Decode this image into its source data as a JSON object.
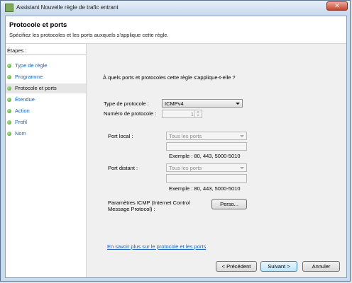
{
  "window": {
    "title": "Assistant Nouvelle règle de trafic entrant"
  },
  "header": {
    "title": "Protocole et ports",
    "subtitle": "Spécifiez les protocoles et les ports auxquels s'applique cette règle."
  },
  "sidebar": {
    "title": "Étapes :",
    "items": [
      {
        "label": "Type de règle",
        "active": false
      },
      {
        "label": "Programme",
        "active": false
      },
      {
        "label": "Protocole et ports",
        "active": true
      },
      {
        "label": "Étendue",
        "active": false
      },
      {
        "label": "Action",
        "active": false
      },
      {
        "label": "Profil",
        "active": false
      },
      {
        "label": "Nom",
        "active": false
      }
    ]
  },
  "main": {
    "question": "À quels ports et protocoles cette règle s'applique-t-elle ?",
    "protocol_type_label": "Type de protocole :",
    "protocol_type_value": "ICMPv4",
    "protocol_number_label": "Numéro de protocole :",
    "protocol_number_value": "1",
    "local_port_label": "Port local :",
    "local_port_value": "Tous les ports",
    "local_port_example": "Exemple : 80, 443, 5000-5010",
    "remote_port_label": "Port distant :",
    "remote_port_value": "Tous les ports",
    "remote_port_example": "Exemple : 80, 443, 5000-5010",
    "icmp_label_line1": "Paramètres ICMP (Internet Control",
    "icmp_label_line2": "Message Protocol) :",
    "icmp_button": "Perso...",
    "learn_more_link": "En savoir plus sur le protocole et les ports"
  },
  "footer": {
    "prev_button": "< Précédent",
    "next_button": "Suivant >",
    "cancel_button": "Annuler"
  },
  "colors": {
    "link": "#1a64bd",
    "window_frame": "#c9dced",
    "close_button": "#c7442e"
  }
}
